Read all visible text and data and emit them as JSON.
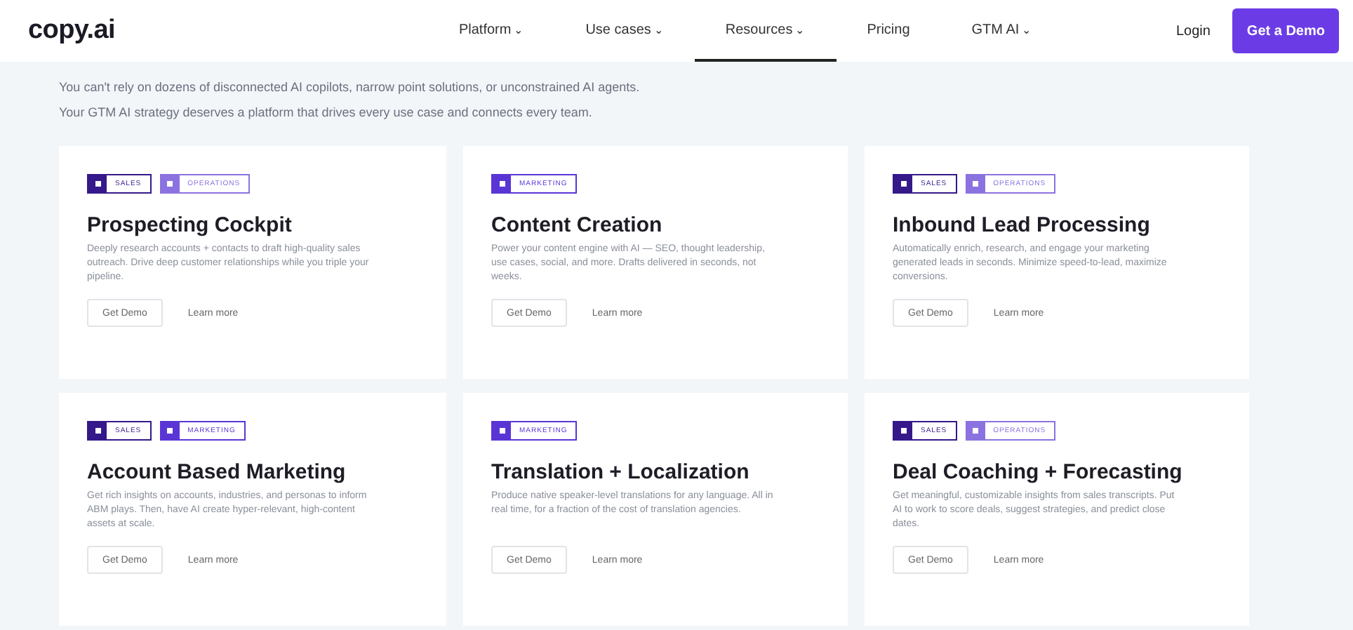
{
  "logo": "copy.ai",
  "nav": [
    {
      "label": "Platform",
      "caret": "⌄",
      "selected": false
    },
    {
      "label": "Use cases",
      "caret": "⌄",
      "selected": false
    },
    {
      "label": "Resources",
      "caret": "⌄",
      "selected": true
    },
    {
      "label": "Pricing",
      "selected": false
    },
    {
      "label": "GTM AI",
      "caret": "⌄",
      "selected": false
    }
  ],
  "login": "Login",
  "cta": "Get a Demo",
  "intro": [
    "You can't rely on dozens of disconnected AI copilots, narrow point solutions, or unconstrained AI agents.",
    "Your GTM AI strategy deserves a platform that drives every use case and connects every team."
  ],
  "cards": [
    {
      "tags": [
        {
          "label": "SALES",
          "color": "#35188a"
        },
        {
          "label": "OPERATIONS",
          "color": "#8b72e0"
        }
      ],
      "title": "Prospecting Cockpit",
      "description": "Deeply research accounts + contacts to draft high-quality sales outreach. Drive deep customer relationships while you triple your pipeline.",
      "buttons": [
        "Get Demo",
        "Learn more"
      ]
    },
    {
      "tags": [
        {
          "label": "MARKETING",
          "color": "#5a35d6"
        }
      ],
      "title": "Content Creation",
      "description": "Power your content engine with AI — SEO, thought leadership, use cases, social, and more. Drafts delivered in seconds, not weeks.",
      "buttons": [
        "Get Demo",
        "Learn more"
      ]
    },
    {
      "tags": [
        {
          "label": "SALES",
          "color": "#35188a"
        },
        {
          "label": "OPERATIONS",
          "color": "#8b72e0"
        }
      ],
      "title": "Inbound Lead Processing",
      "description": "Automatically enrich, research, and engage your marketing generated leads in seconds. Minimize speed-to-lead, maximize conversions.",
      "buttons": [
        "Get Demo",
        "Learn more"
      ]
    },
    {
      "tags": [
        {
          "label": "SALES",
          "color": "#35188a"
        },
        {
          "label": "MARKETING",
          "color": "#5a35d6"
        }
      ],
      "title": "Account Based Marketing",
      "description": "Get rich insights on accounts, industries, and personas to inform ABM plays. Then, have AI create hyper-relevant, high-content assets at scale.",
      "buttons": [
        "Get Demo",
        "Learn more"
      ]
    },
    {
      "tags": [
        {
          "label": "MARKETING",
          "color": "#5a35d6"
        }
      ],
      "title": "Translation + Localization",
      "description": "Produce native speaker-level translations for any language. All in real time, for a fraction of the cost of translation agencies.",
      "buttons": [
        "Get Demo",
        "Learn more"
      ]
    },
    {
      "tags": [
        {
          "label": "SALES",
          "color": "#35188a"
        },
        {
          "label": "OPERATIONS",
          "color": "#8b72e0"
        }
      ],
      "title": "Deal Coaching + Forecasting",
      "description": "Get meaningful, customizable insights from sales transcripts. Put AI to work to score deals, suggest strategies, and predict close dates.",
      "buttons": [
        "Get Demo",
        "Learn more"
      ]
    }
  ]
}
